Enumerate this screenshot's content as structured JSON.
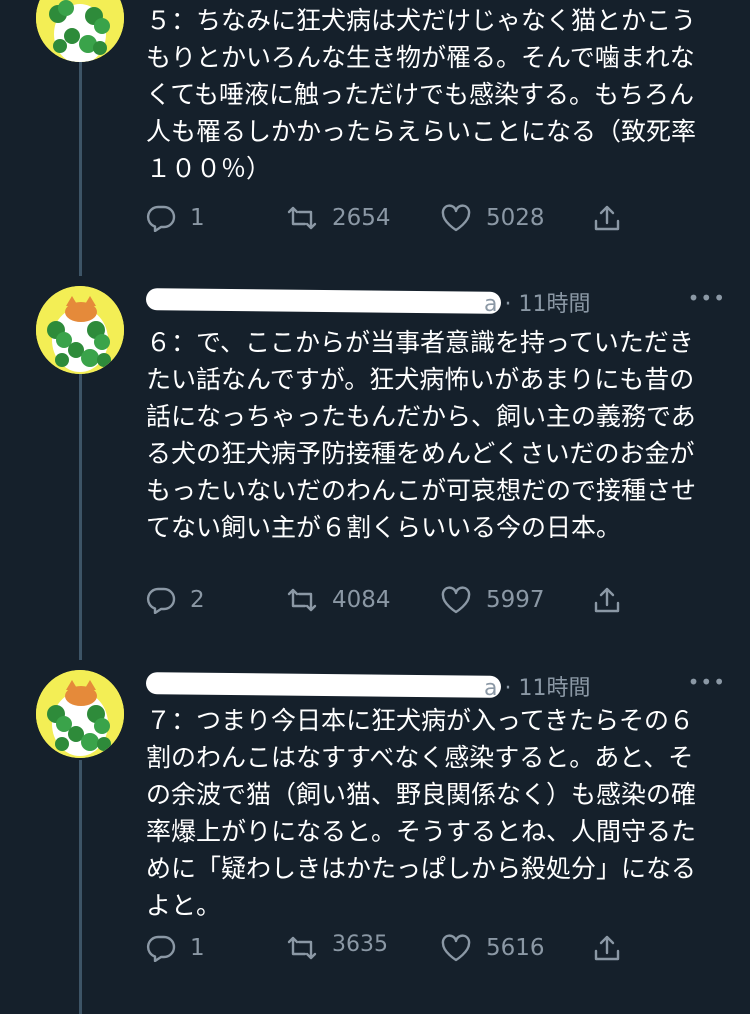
{
  "tweets": [
    {
      "text": "５：ちなみに狂犬病は犬だけじゃなく猫とかこうもりとかいろんな生き物が罹る。そんで噛まれなくても唾液に触っただけでも感染する。もちろん人も罹るしかかったらえらいことになる（致死率１００％）",
      "replies": "1",
      "retweets": "2654",
      "likes": "5028"
    },
    {
      "handle_tail": "a · 11時間",
      "more": "•••",
      "text": "６：で、ここからが当事者意識を持っていただきたい話なんですが。狂犬病怖いがあまりにも昔の話になっちゃったもんだから、飼い主の義務である犬の狂犬病予防接種をめんどくさいだのお金がもったいないだのわんこが可哀想だので接種させてない飼い主が６割くらいいる今の日本。",
      "replies": "2",
      "retweets": "4084",
      "likes": "5997"
    },
    {
      "handle_tail": "a · 11時間",
      "more": "•••",
      "text": "７：つまり今日本に狂犬病が入ってきたらその６割のわんこはなすすべなく感染すると。あと、その余波で猫（飼い猫、野良関係なく）も感染の確率爆上がりになると。そうするとね、人間守るために「疑わしきはかたっぱしから殺処分」になるよと。",
      "replies": "1",
      "retweets": "3635",
      "likes": "5616"
    }
  ],
  "colors": {
    "background": "#15202b",
    "text": "#ffffff",
    "muted": "#8b98a5",
    "thread_line": "#3d5466"
  }
}
